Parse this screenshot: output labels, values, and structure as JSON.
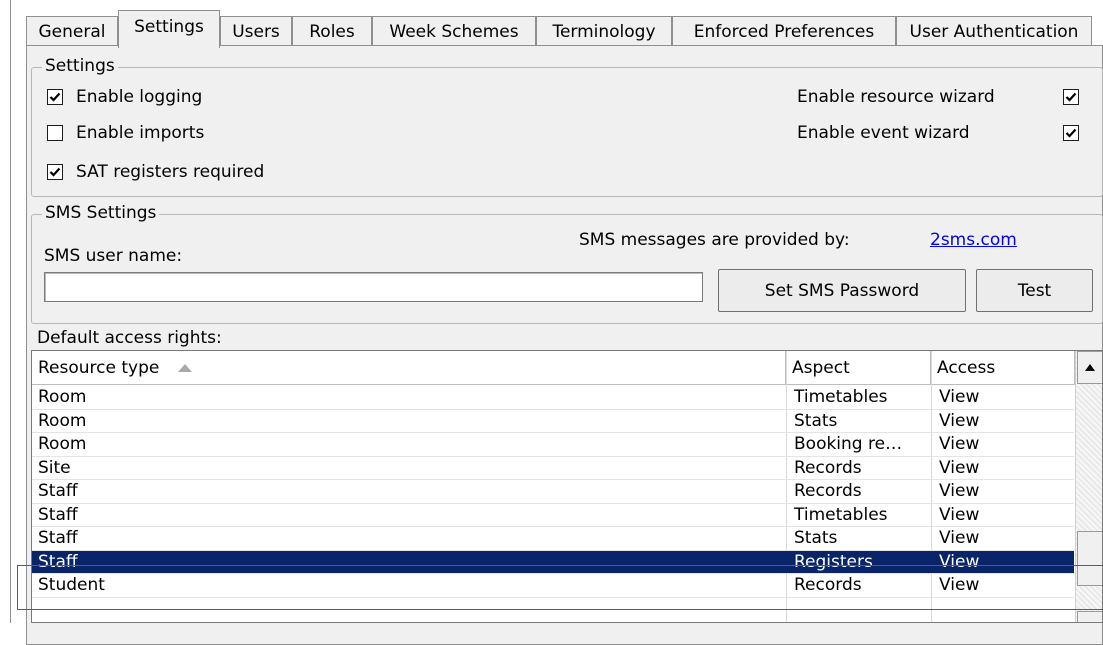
{
  "tabs": [
    {
      "label": "General"
    },
    {
      "label": "Settings"
    },
    {
      "label": "Users"
    },
    {
      "label": "Roles"
    },
    {
      "label": "Week Schemes"
    },
    {
      "label": "Terminology"
    },
    {
      "label": "Enforced Preferences"
    },
    {
      "label": "User Authentication"
    }
  ],
  "active_tab": "Settings",
  "settings": {
    "legend": "Settings",
    "enable_logging": {
      "label": "Enable logging",
      "checked": true
    },
    "enable_imports": {
      "label": "Enable imports",
      "checked": false
    },
    "sat_registers": {
      "label": "SAT registers required",
      "checked": true
    },
    "enable_resource_wizard": {
      "label": "Enable resource wizard",
      "checked": true
    },
    "enable_event_wizard": {
      "label": "Enable event wizard",
      "checked": true
    }
  },
  "sms": {
    "legend": "SMS Settings",
    "user_name_label": "SMS user name:",
    "user_name_value": "",
    "provided_by_label": "SMS messages are provided by:",
    "provider_link": "2sms.com",
    "set_password_button": "Set SMS Password",
    "test_button": "Test"
  },
  "access": {
    "label": "Default access rights:",
    "columns": {
      "resource_type": "Resource type",
      "aspect": "Aspect",
      "access": "Access"
    },
    "rows": [
      {
        "resource": "Room",
        "aspect": "Timetables",
        "access": "View"
      },
      {
        "resource": "Room",
        "aspect": "Stats",
        "access": "View"
      },
      {
        "resource": "Room",
        "aspect": "Booking re…",
        "access": "View"
      },
      {
        "resource": "Site",
        "aspect": "Records",
        "access": "View"
      },
      {
        "resource": "Staff",
        "aspect": "Records",
        "access": "View"
      },
      {
        "resource": "Staff",
        "aspect": "Timetables",
        "access": "View"
      },
      {
        "resource": "Staff",
        "aspect": "Stats",
        "access": "View"
      },
      {
        "resource": "Staff",
        "aspect": "Registers",
        "access": "View",
        "selected": true
      },
      {
        "resource": "Student",
        "aspect": "Records",
        "access": "View"
      }
    ]
  }
}
